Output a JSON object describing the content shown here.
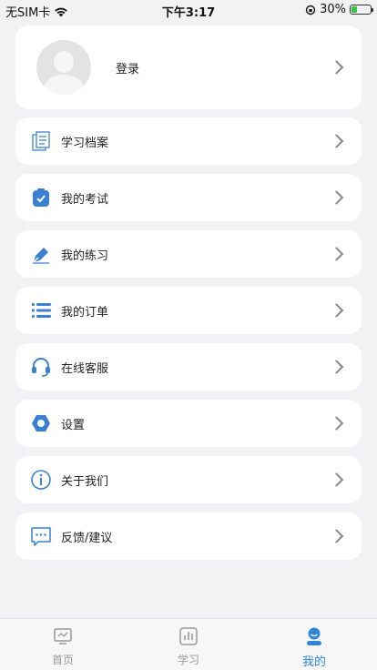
{
  "status_bar": {
    "carrier": "无SIM卡",
    "time": "下午3:17",
    "battery": "30%"
  },
  "profile": {
    "login_label": "登录"
  },
  "menu": [
    {
      "label": "学习档案",
      "icon": "document-icon"
    },
    {
      "label": "我的考试",
      "icon": "exam-icon"
    },
    {
      "label": "我的练习",
      "icon": "pen-icon"
    },
    {
      "label": "我的订单",
      "icon": "list-icon"
    },
    {
      "label": "在线客服",
      "icon": "headset-icon"
    },
    {
      "label": "设置",
      "icon": "settings-icon"
    },
    {
      "label": "关于我们",
      "icon": "info-icon"
    },
    {
      "label": "反馈/建议",
      "icon": "feedback-icon"
    }
  ],
  "tabbar": {
    "tabs": [
      {
        "label": "首页",
        "icon": "monitor-icon"
      },
      {
        "label": "学习",
        "icon": "chart-icon"
      },
      {
        "label": "我的",
        "icon": "user-icon"
      }
    ],
    "active_index": 2
  },
  "colors": {
    "accent": "#2f86d8",
    "icon_blue": "#4a8fd6",
    "background": "#f2f2f4"
  }
}
